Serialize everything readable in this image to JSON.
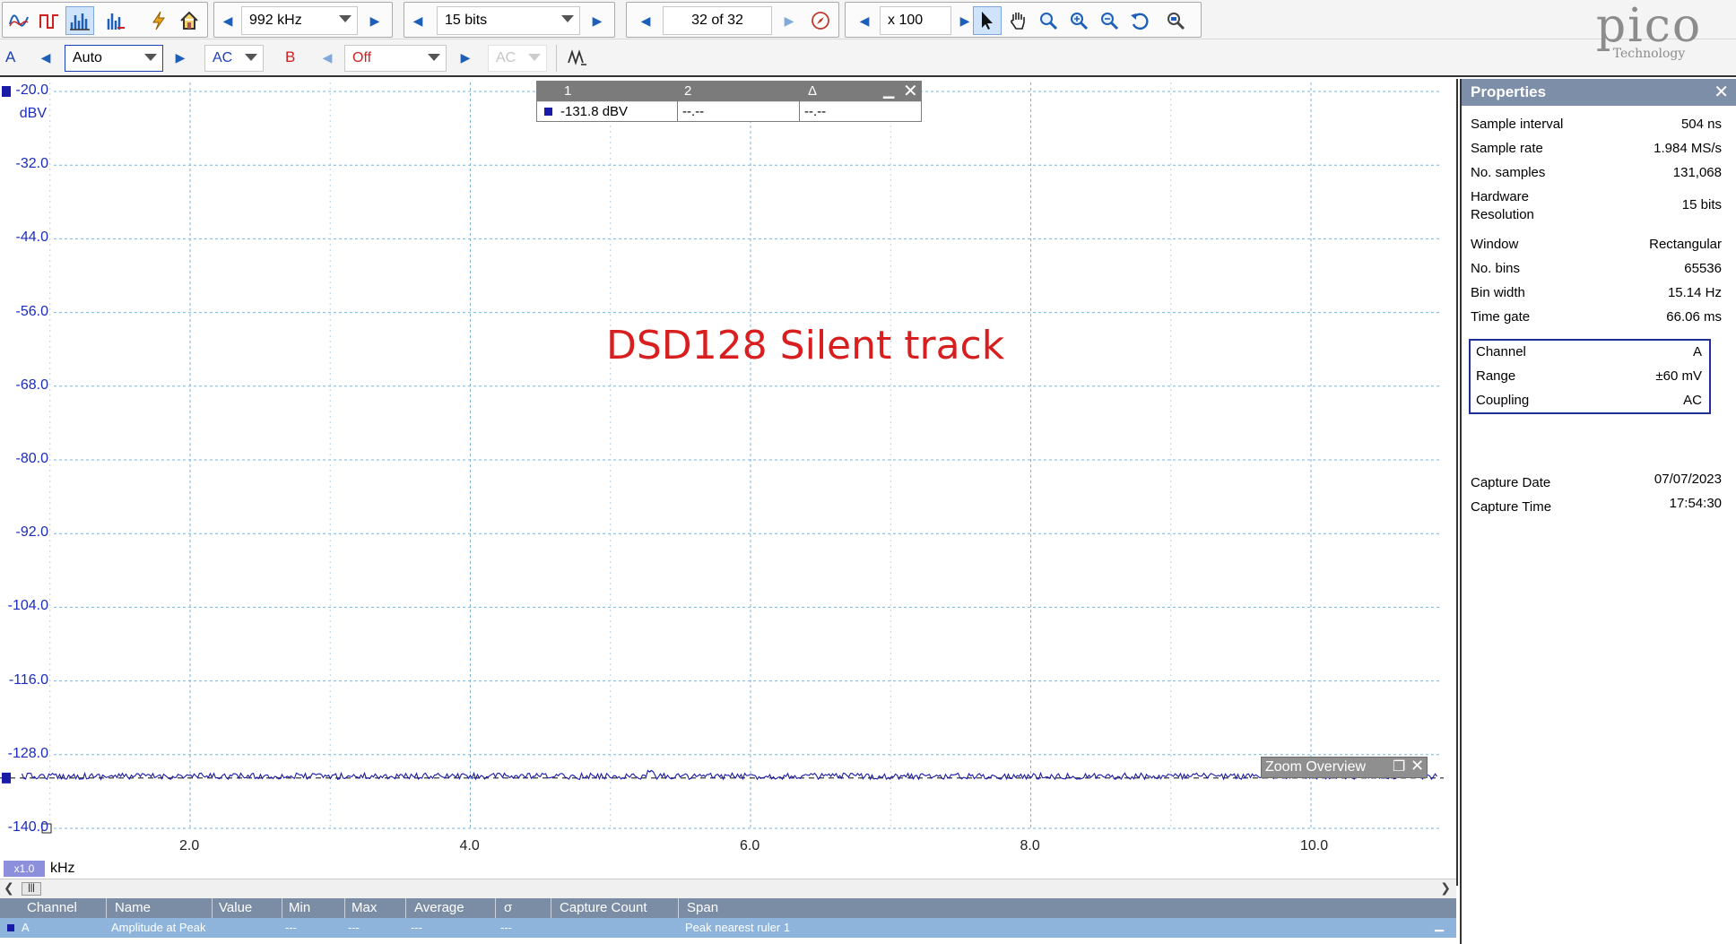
{
  "toolbar": {
    "mode_icons": [
      "scope-mode-icon",
      "persistence-mode-icon",
      "spectrum-mode-icon",
      "spectrum-view-icon",
      "auto-setup-icon",
      "home-icon"
    ],
    "spectrum_range": "992 kHz",
    "resolution": "15 bits",
    "capture_position": "32 of 32",
    "zoom_factor": "x 100"
  },
  "channel_a": {
    "label": "A",
    "range": "Auto",
    "coupling": "AC"
  },
  "channel_b": {
    "label": "B",
    "range": "Off",
    "coupling": "AC"
  },
  "logo": {
    "name": "pico",
    "sub": "Technology"
  },
  "plot": {
    "y_unit": "dBV",
    "y_ticks": [
      "-20.0",
      "-32.0",
      "-44.0",
      "-56.0",
      "-68.0",
      "-80.0",
      "-92.0",
      "-104.0",
      "-116.0",
      "-128.0",
      "-140.0"
    ],
    "x_ticks": [
      "2.0",
      "4.0",
      "6.0",
      "8.0",
      "10.0"
    ],
    "x_unit": "kHz",
    "x_zoom": "x1.0",
    "annotation": "DSD128 Silent track",
    "zoom_overview": "Zoom Overview"
  },
  "ruler": {
    "headers": [
      "1",
      "2",
      "Δ"
    ],
    "values": [
      "-131.8 dBV",
      "--.--",
      "--.--"
    ]
  },
  "properties": {
    "title": "Properties",
    "rows": [
      {
        "k": "Sample interval",
        "v": "504 ns"
      },
      {
        "k": "Sample rate",
        "v": "1.984 MS/s"
      },
      {
        "k": "No. samples",
        "v": "131,068"
      },
      {
        "k": "Hardware Resolution",
        "v": "15 bits"
      },
      {
        "k": "Window",
        "v": "Rectangular"
      },
      {
        "k": "No. bins",
        "v": "65536"
      },
      {
        "k": "Bin width",
        "v": "15.14 Hz"
      },
      {
        "k": "Time gate",
        "v": "66.06 ms"
      }
    ],
    "channel_rows": [
      {
        "k": "Channel",
        "v": "A"
      },
      {
        "k": "Range",
        "v": "±60 mV"
      },
      {
        "k": "Coupling",
        "v": "AC"
      }
    ],
    "capture_rows": [
      {
        "k": "Capture Date",
        "v": "07/07/2023"
      },
      {
        "k": "Capture Time",
        "v": "17:54:30"
      }
    ]
  },
  "measurements": {
    "headers": [
      "Channel",
      "Name",
      "Value",
      "Min",
      "Max",
      "Average",
      "σ",
      "Capture Count",
      "Span"
    ],
    "row": [
      "A",
      "Amplitude at Peak",
      "",
      "---",
      "---",
      "---",
      "---",
      "",
      "Peak nearest ruler 1"
    ]
  },
  "chart_data": {
    "type": "line",
    "xlabel": "kHz",
    "ylabel": "dBV",
    "xlim": [
      0.5,
      11.0
    ],
    "ylim": [
      -140.0,
      -20.0
    ],
    "series": [
      {
        "name": "A",
        "color": "#1a1aa8",
        "mean": -131.8,
        "x_range": [
          0.8,
          10.9
        ]
      }
    ]
  }
}
